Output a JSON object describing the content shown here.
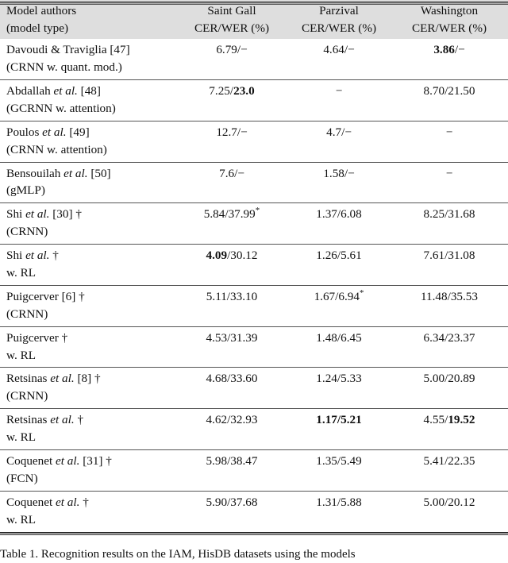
{
  "table": {
    "columns": [
      {
        "key": "author",
        "line1": "Model authors",
        "line2": "(model type)"
      },
      {
        "key": "saint",
        "line1": "Saint Gall",
        "line2": "CER/WER (%)"
      },
      {
        "key": "parzival",
        "line1": "Parzival",
        "line2": "CER/WER (%)"
      },
      {
        "key": "wash",
        "line1": "Washington",
        "line2": "CER/WER (%)"
      }
    ],
    "rows": [
      {
        "name_line1": "Davoudi & Traviglia [47]",
        "name_line2": "(CRNN w. quant. mod.)",
        "saint": "6.79/−",
        "parzival": "4.64/−",
        "wash": "3.86/−",
        "saint_bold": "",
        "parzival_bold": "",
        "wash_bold": "3.86"
      },
      {
        "name_line1": "Abdallah et al. [48]",
        "name_line2": "(GCRNN w. attention)",
        "saint": "7.25/23.0",
        "parzival": "−",
        "wash": "8.70/21.50",
        "saint_bold": "23.0",
        "parzival_bold": "",
        "wash_bold": ""
      },
      {
        "name_line1": "Poulos et al. [49]",
        "name_line2": "(CRNN w. attention)",
        "saint": "12.7/−",
        "parzival": "4.7/−",
        "wash": "−",
        "saint_bold": "",
        "parzival_bold": "",
        "wash_bold": ""
      },
      {
        "name_line1": "Bensouilah et al. [50]",
        "name_line2": "(gMLP)",
        "saint": "7.6/−",
        "parzival": "1.58/−",
        "wash": "−",
        "saint_bold": "",
        "parzival_bold": "",
        "wash_bold": ""
      },
      {
        "name_line1": "Shi et al. [30] †",
        "name_line2": "(CRNN)",
        "saint": "5.84/37.99*",
        "parzival": "1.37/6.08",
        "wash": "8.25/31.68",
        "saint_bold": "",
        "parzival_bold": "",
        "wash_bold": ""
      },
      {
        "name_line1": "Shi et al. †",
        "name_line2": "w. RL",
        "saint": "4.09/30.12",
        "parzival": "1.26/5.61",
        "wash": "7.61/31.08",
        "saint_bold": "4.09",
        "parzival_bold": "",
        "wash_bold": ""
      },
      {
        "name_line1": "Puigcerver [6] †",
        "name_line2": "(CRNN)",
        "saint": "5.11/33.10",
        "parzival": "1.67/6.94*",
        "wash": "11.48/35.53",
        "saint_bold": "",
        "parzival_bold": "",
        "wash_bold": ""
      },
      {
        "name_line1": "Puigcerver †",
        "name_line2": "w. RL",
        "saint": "4.53/31.39",
        "parzival": "1.48/6.45",
        "wash": "6.34/23.37",
        "saint_bold": "",
        "parzival_bold": "",
        "wash_bold": ""
      },
      {
        "name_line1": "Retsinas et al. [8] †",
        "name_line2": "(CRNN)",
        "saint": "4.68/33.60",
        "parzival": "1.24/5.33",
        "wash": "5.00/20.89",
        "saint_bold": "",
        "parzival_bold": "",
        "wash_bold": ""
      },
      {
        "name_line1": "Retsinas et al. †",
        "name_line2": "w. RL",
        "saint": "4.62/32.93",
        "parzival": "1.17/5.21",
        "wash": "4.55/19.52",
        "saint_bold": "",
        "parzival_bold": "1.17/5.21",
        "wash_bold": "19.52"
      },
      {
        "name_line1": "Coquenet et al. [31] †",
        "name_line2": "(FCN)",
        "saint": "5.98/38.47",
        "parzival": "1.35/5.49",
        "wash": "5.41/22.35",
        "saint_bold": "",
        "parzival_bold": "",
        "wash_bold": ""
      },
      {
        "name_line1": "Coquenet et al. †",
        "name_line2": "w. RL",
        "saint": "5.90/37.68",
        "parzival": "1.31/5.88",
        "wash": "5.00/20.12",
        "saint_bold": "",
        "parzival_bold": "",
        "wash_bold": ""
      }
    ]
  },
  "caption": {
    "text": "Table 1. Recognition results on the IAM, HisDB datasets using the models"
  },
  "colors": {
    "header_background": "#dedede",
    "rule": "#555555",
    "text": "#111111"
  }
}
